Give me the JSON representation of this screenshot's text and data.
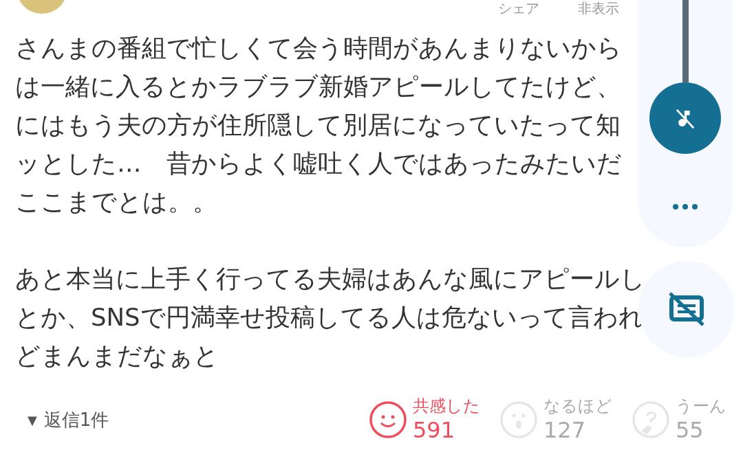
{
  "header_actions": [
    "シェア",
    "非表示"
  ],
  "comment": {
    "paragraphs": [
      {
        "lines": [
          "さんまの番組で忙しくて会う時間があんまりないから",
          "は一緒に入るとかラブラブ新婚アピールしてたけど、",
          "にはもう夫の方が住所隠して別居になっていたって知",
          "ッとした…　昔からよく嘘吐く人ではあったみたいだ",
          "ここまでとは。。"
        ]
      },
      {
        "lines": [
          "あと本当に上手く行ってる夫婦はあんな風にアピールし",
          "とか、SNSで円満幸せ投稿してる人は危ないって言われ",
          "どまんまだなぁと"
        ]
      }
    ]
  },
  "replies": {
    "arrow": "▼",
    "label": "返信1件"
  },
  "reactions": [
    {
      "kind": "smile",
      "label": "共感した",
      "count": "591",
      "selected": true
    },
    {
      "kind": "surprise",
      "label": "なるほど",
      "count": "127",
      "selected": false
    },
    {
      "kind": "doubt",
      "label": "うーん",
      "count": "55",
      "selected": false
    }
  ],
  "overlay": {
    "music_muted": true,
    "captions_off": true
  }
}
